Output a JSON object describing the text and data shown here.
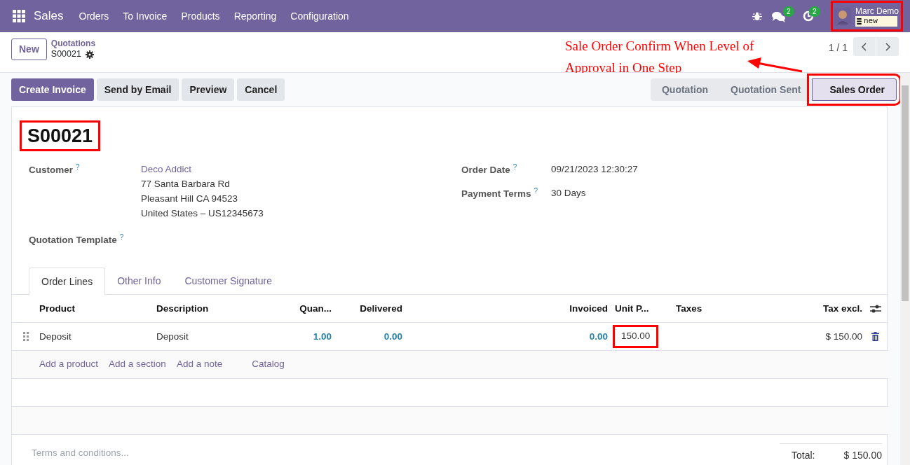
{
  "navbar": {
    "app": "Sales",
    "menus": [
      "Orders",
      "To Invoice",
      "Products",
      "Reporting",
      "Configuration"
    ],
    "messages_badge": "2",
    "activities_badge": "2",
    "user": {
      "name": "Marc Demo",
      "database": "new",
      "highlighted": true
    }
  },
  "control_panel": {
    "new_button": "New",
    "breadcrumb": "Quotations",
    "record": "S00021",
    "pager": "1 / 1"
  },
  "annotation": {
    "text": "Sale Order Confirm When Level of Approval in One Step"
  },
  "actions": [
    {
      "label": "Create Invoice",
      "primary": true
    },
    {
      "label": "Send by Email",
      "primary": false
    },
    {
      "label": "Preview",
      "primary": false
    },
    {
      "label": "Cancel",
      "primary": false
    }
  ],
  "statusbar": [
    {
      "label": "Quotation",
      "selected": false,
      "highlighted": false
    },
    {
      "label": "Quotation Sent",
      "selected": false,
      "highlighted": false
    },
    {
      "label": "Sales Order",
      "selected": true,
      "highlighted": true
    }
  ],
  "form": {
    "title": "S00021",
    "title_highlighted": true,
    "left_fields": [
      {
        "label": "Customer",
        "help": "?",
        "link": "Deco Addict",
        "lines": [
          "77 Santa Barbara Rd",
          "Pleasant Hill CA 94523",
          "United States – US12345673"
        ]
      },
      {
        "label": "Quotation Template",
        "help": "?"
      }
    ],
    "right_fields": [
      {
        "label": "Order Date",
        "help": "?",
        "lines": [
          "09/21/2023 12:30:27"
        ]
      },
      {
        "label": "Payment Terms",
        "help": "?",
        "lines": [
          "30 Days"
        ]
      }
    ]
  },
  "tabs": [
    {
      "label": "Order Lines",
      "selected": true
    },
    {
      "label": "Other Info",
      "selected": false
    },
    {
      "label": "Customer Signature",
      "selected": false
    }
  ],
  "table": {
    "columns": [
      "Product",
      "Description",
      "Quan...",
      "Delivered",
      "Invoiced",
      "Unit P...",
      "Taxes",
      "Tax excl."
    ],
    "rows": [
      {
        "cells": [
          {
            "kind": "text",
            "text": "Deposit"
          },
          {
            "kind": "text",
            "text": "Deposit"
          },
          {
            "kind": "number",
            "text": "1.00"
          },
          {
            "kind": "number",
            "text": "0.00"
          },
          {
            "kind": "number",
            "text": "0.00"
          },
          {
            "kind": "text",
            "text": "150.00",
            "highlighted": true
          },
          {
            "kind": "empty"
          },
          {
            "kind": "text",
            "text": "$ 150.00"
          }
        ]
      }
    ],
    "add_links": [
      "Add a product",
      "Add a section",
      "Add a note"
    ],
    "catalog": "Catalog"
  },
  "terms": {
    "placeholder": "Terms and conditions..."
  },
  "total": {
    "label": "Total:",
    "value": "$ 150.00"
  }
}
